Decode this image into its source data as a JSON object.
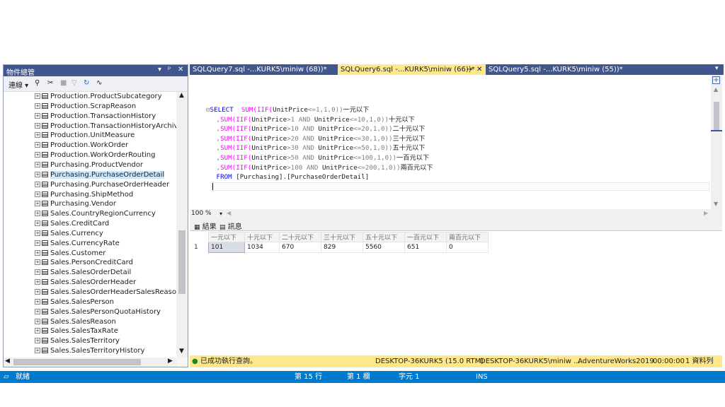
{
  "object_explorer": {
    "title": "物件總管",
    "title_controls": [
      "▾",
      "ᵖ",
      "✕"
    ],
    "toolbar": {
      "connect_label": "連線 ▾"
    },
    "items": [
      {
        "label": "Production.ProductSubcategory"
      },
      {
        "label": "Production.ScrapReason"
      },
      {
        "label": "Production.TransactionHistory"
      },
      {
        "label": "Production.TransactionHistoryArchive"
      },
      {
        "label": "Production.UnitMeasure"
      },
      {
        "label": "Production.WorkOrder"
      },
      {
        "label": "Production.WorkOrderRouting"
      },
      {
        "label": "Purchasing.ProductVendor"
      },
      {
        "label": "Purchasing.PurchaseOrderDetail",
        "selected": true
      },
      {
        "label": "Purchasing.PurchaseOrderHeader"
      },
      {
        "label": "Purchasing.ShipMethod"
      },
      {
        "label": "Purchasing.Vendor"
      },
      {
        "label": "Sales.CountryRegionCurrency"
      },
      {
        "label": "Sales.CreditCard"
      },
      {
        "label": "Sales.Currency"
      },
      {
        "label": "Sales.CurrencyRate"
      },
      {
        "label": "Sales.Customer"
      },
      {
        "label": "Sales.PersonCreditCard"
      },
      {
        "label": "Sales.SalesOrderDetail"
      },
      {
        "label": "Sales.SalesOrderHeader"
      },
      {
        "label": "Sales.SalesOrderHeaderSalesReason"
      },
      {
        "label": "Sales.SalesPerson"
      },
      {
        "label": "Sales.SalesPersonQuotaHistory"
      },
      {
        "label": "Sales.SalesReason"
      },
      {
        "label": "Sales.SalesTaxRate"
      },
      {
        "label": "Sales.SalesTerritory"
      },
      {
        "label": "Sales.SalesTerritoryHistory"
      }
    ]
  },
  "tabs": [
    {
      "label": "SQLQuery7.sql -...KURK5\\miniw (68))*"
    },
    {
      "label": "SQLQuery6.sql -...KURK5\\miniw (66))*",
      "active": true,
      "pin": "⊸",
      "close": "✕"
    },
    {
      "label": "SQLQuery5.sql -...KURK5\\miniw (55))*"
    }
  ],
  "editor": {
    "lines": [
      [
        {
          "t": "⊟",
          "c": "gr"
        },
        {
          "t": "SELECT ",
          "c": "kw"
        },
        {
          "t": " SUM(IIF(",
          "c": "fn"
        },
        {
          "t": "UnitPrice",
          "c": "tx"
        },
        {
          "t": "<=1,1,0))",
          "c": "gr"
        },
        {
          "t": "一元以下",
          "c": "tx"
        }
      ],
      [
        {
          "t": " ,",
          "c": "gr"
        },
        {
          "t": "SUM(IIF(",
          "c": "fn"
        },
        {
          "t": "UnitPrice",
          "c": "tx"
        },
        {
          "t": ">1 ",
          "c": "gr"
        },
        {
          "t": "AND ",
          "c": "gr"
        },
        {
          "t": "UnitPrice",
          "c": "tx"
        },
        {
          "t": "<=10,1,0))",
          "c": "gr"
        },
        {
          "t": "十元以下",
          "c": "tx"
        }
      ],
      [
        {
          "t": " ,",
          "c": "gr"
        },
        {
          "t": "SUM(IIF(",
          "c": "fn"
        },
        {
          "t": "UnitPrice",
          "c": "tx"
        },
        {
          "t": ">10 ",
          "c": "gr"
        },
        {
          "t": "AND ",
          "c": "gr"
        },
        {
          "t": "UnitPrice",
          "c": "tx"
        },
        {
          "t": "<=20,1,0))",
          "c": "gr"
        },
        {
          "t": "二十元以下",
          "c": "tx"
        }
      ],
      [
        {
          "t": " ,",
          "c": "gr"
        },
        {
          "t": "SUM(IIF(",
          "c": "fn"
        },
        {
          "t": "UnitPrice",
          "c": "tx"
        },
        {
          "t": ">20 ",
          "c": "gr"
        },
        {
          "t": "AND ",
          "c": "gr"
        },
        {
          "t": "UnitPrice",
          "c": "tx"
        },
        {
          "t": "<=30,1,0))",
          "c": "gr"
        },
        {
          "t": "三十元以下",
          "c": "tx"
        }
      ],
      [
        {
          "t": " ,",
          "c": "gr"
        },
        {
          "t": "SUM(IIF(",
          "c": "fn"
        },
        {
          "t": "UnitPrice",
          "c": "tx"
        },
        {
          "t": ">30 ",
          "c": "gr"
        },
        {
          "t": "AND ",
          "c": "gr"
        },
        {
          "t": "UnitPrice",
          "c": "tx"
        },
        {
          "t": "<=50,1,0))",
          "c": "gr"
        },
        {
          "t": "五十元以下",
          "c": "tx"
        }
      ],
      [
        {
          "t": " ,",
          "c": "gr"
        },
        {
          "t": "SUM(IIF(",
          "c": "fn"
        },
        {
          "t": "UnitPrice",
          "c": "tx"
        },
        {
          "t": ">50 ",
          "c": "gr"
        },
        {
          "t": "AND ",
          "c": "gr"
        },
        {
          "t": "UnitPrice",
          "c": "tx"
        },
        {
          "t": "<=100,1,0))",
          "c": "gr"
        },
        {
          "t": "一百元以下",
          "c": "tx"
        }
      ],
      [
        {
          "t": " ,",
          "c": "gr"
        },
        {
          "t": "SUM(IIF(",
          "c": "fn"
        },
        {
          "t": "UnitPrice",
          "c": "tx"
        },
        {
          "t": ">100 ",
          "c": "gr"
        },
        {
          "t": "AND ",
          "c": "gr"
        },
        {
          "t": "UnitPrice",
          "c": "tx"
        },
        {
          "t": "<=200,1,0))",
          "c": "gr"
        },
        {
          "t": "兩百元以下",
          "c": "tx"
        }
      ],
      [
        {
          "t": " FROM ",
          "c": "kw"
        },
        {
          "t": "[Purchasing].[PurchaseOrderDetail]",
          "c": "tx"
        }
      ]
    ]
  },
  "zoom": {
    "value": "100 %"
  },
  "results": {
    "tabs": [
      {
        "label": "結果"
      },
      {
        "label": "訊息"
      }
    ],
    "columns": [
      "一元以下",
      "十元以下",
      "二十元以下",
      "三十元以下",
      "五十元以下",
      "一百元以下",
      "兩百元以下"
    ],
    "rows": [
      {
        "num": "1",
        "cells": [
          "101",
          "1034",
          "670",
          "829",
          "5560",
          "651",
          "0"
        ]
      }
    ]
  },
  "query_status": {
    "message": "已成功執行查詢。",
    "server": "DESKTOP-36KURK5 (15.0 RTM)",
    "user": "DESKTOP-36KURK5\\miniw ...",
    "database": "AdventureWorks2019",
    "elapsed": "00:00:00",
    "row_count": "1 資料列"
  },
  "app_status": {
    "ready": "就緒",
    "line": "第 15 行",
    "col": "第 1 欄",
    "char": "字元 1",
    "mode": "INS"
  },
  "colors": {
    "title_bar": "#40568d",
    "active_tab": "#ffe88c",
    "status_bar": "#007acc",
    "keyword": "#0000ff",
    "function": "#ff00ff"
  }
}
